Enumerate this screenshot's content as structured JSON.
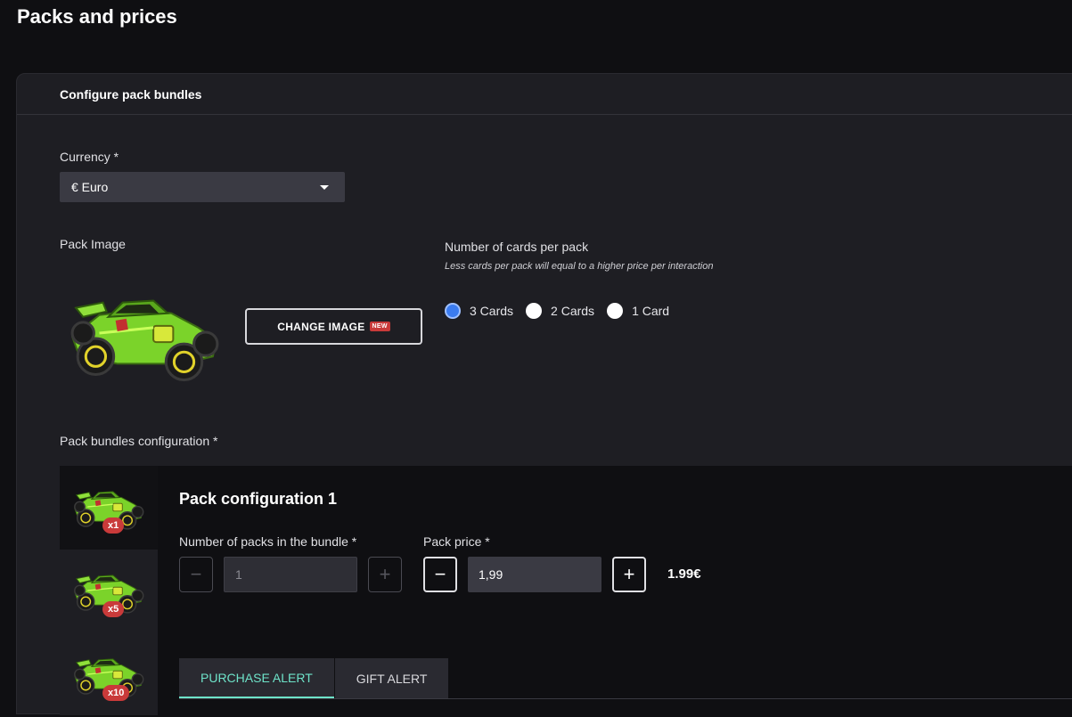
{
  "page": {
    "title": "Packs and prices"
  },
  "panel": {
    "header": "Configure pack bundles"
  },
  "currency": {
    "label": "Currency *",
    "value": "€ Euro"
  },
  "pack_image": {
    "label": "Pack Image",
    "change_button": "CHANGE IMAGE",
    "badge": "NEW"
  },
  "cards_per_pack": {
    "label": "Number of cards per pack",
    "note": "Less cards per pack will equal to a higher price per interaction",
    "options": [
      "3 Cards",
      "2 Cards",
      "1 Card"
    ],
    "selected": "3 Cards"
  },
  "bundles": {
    "label": "Pack bundles configuration *",
    "thumbs": [
      "x1",
      "x5",
      "x10"
    ],
    "config": {
      "title": "Pack configuration 1",
      "packs_label": "Number of packs in the bundle *",
      "packs_value": "1",
      "price_label": "Pack price *",
      "price_value": "1,99",
      "price_display": "1.99€",
      "minus": "−",
      "plus": "+"
    },
    "tabs": [
      "PURCHASE ALERT",
      "GIFT ALERT"
    ]
  },
  "colors": {
    "accent": "#6ee3c9",
    "badge": "#c93a3a",
    "radio_selected": "#3b7cf0"
  },
  "icons": [
    "car-icon",
    "chevron-down-icon",
    "minus-icon",
    "plus-icon"
  ]
}
